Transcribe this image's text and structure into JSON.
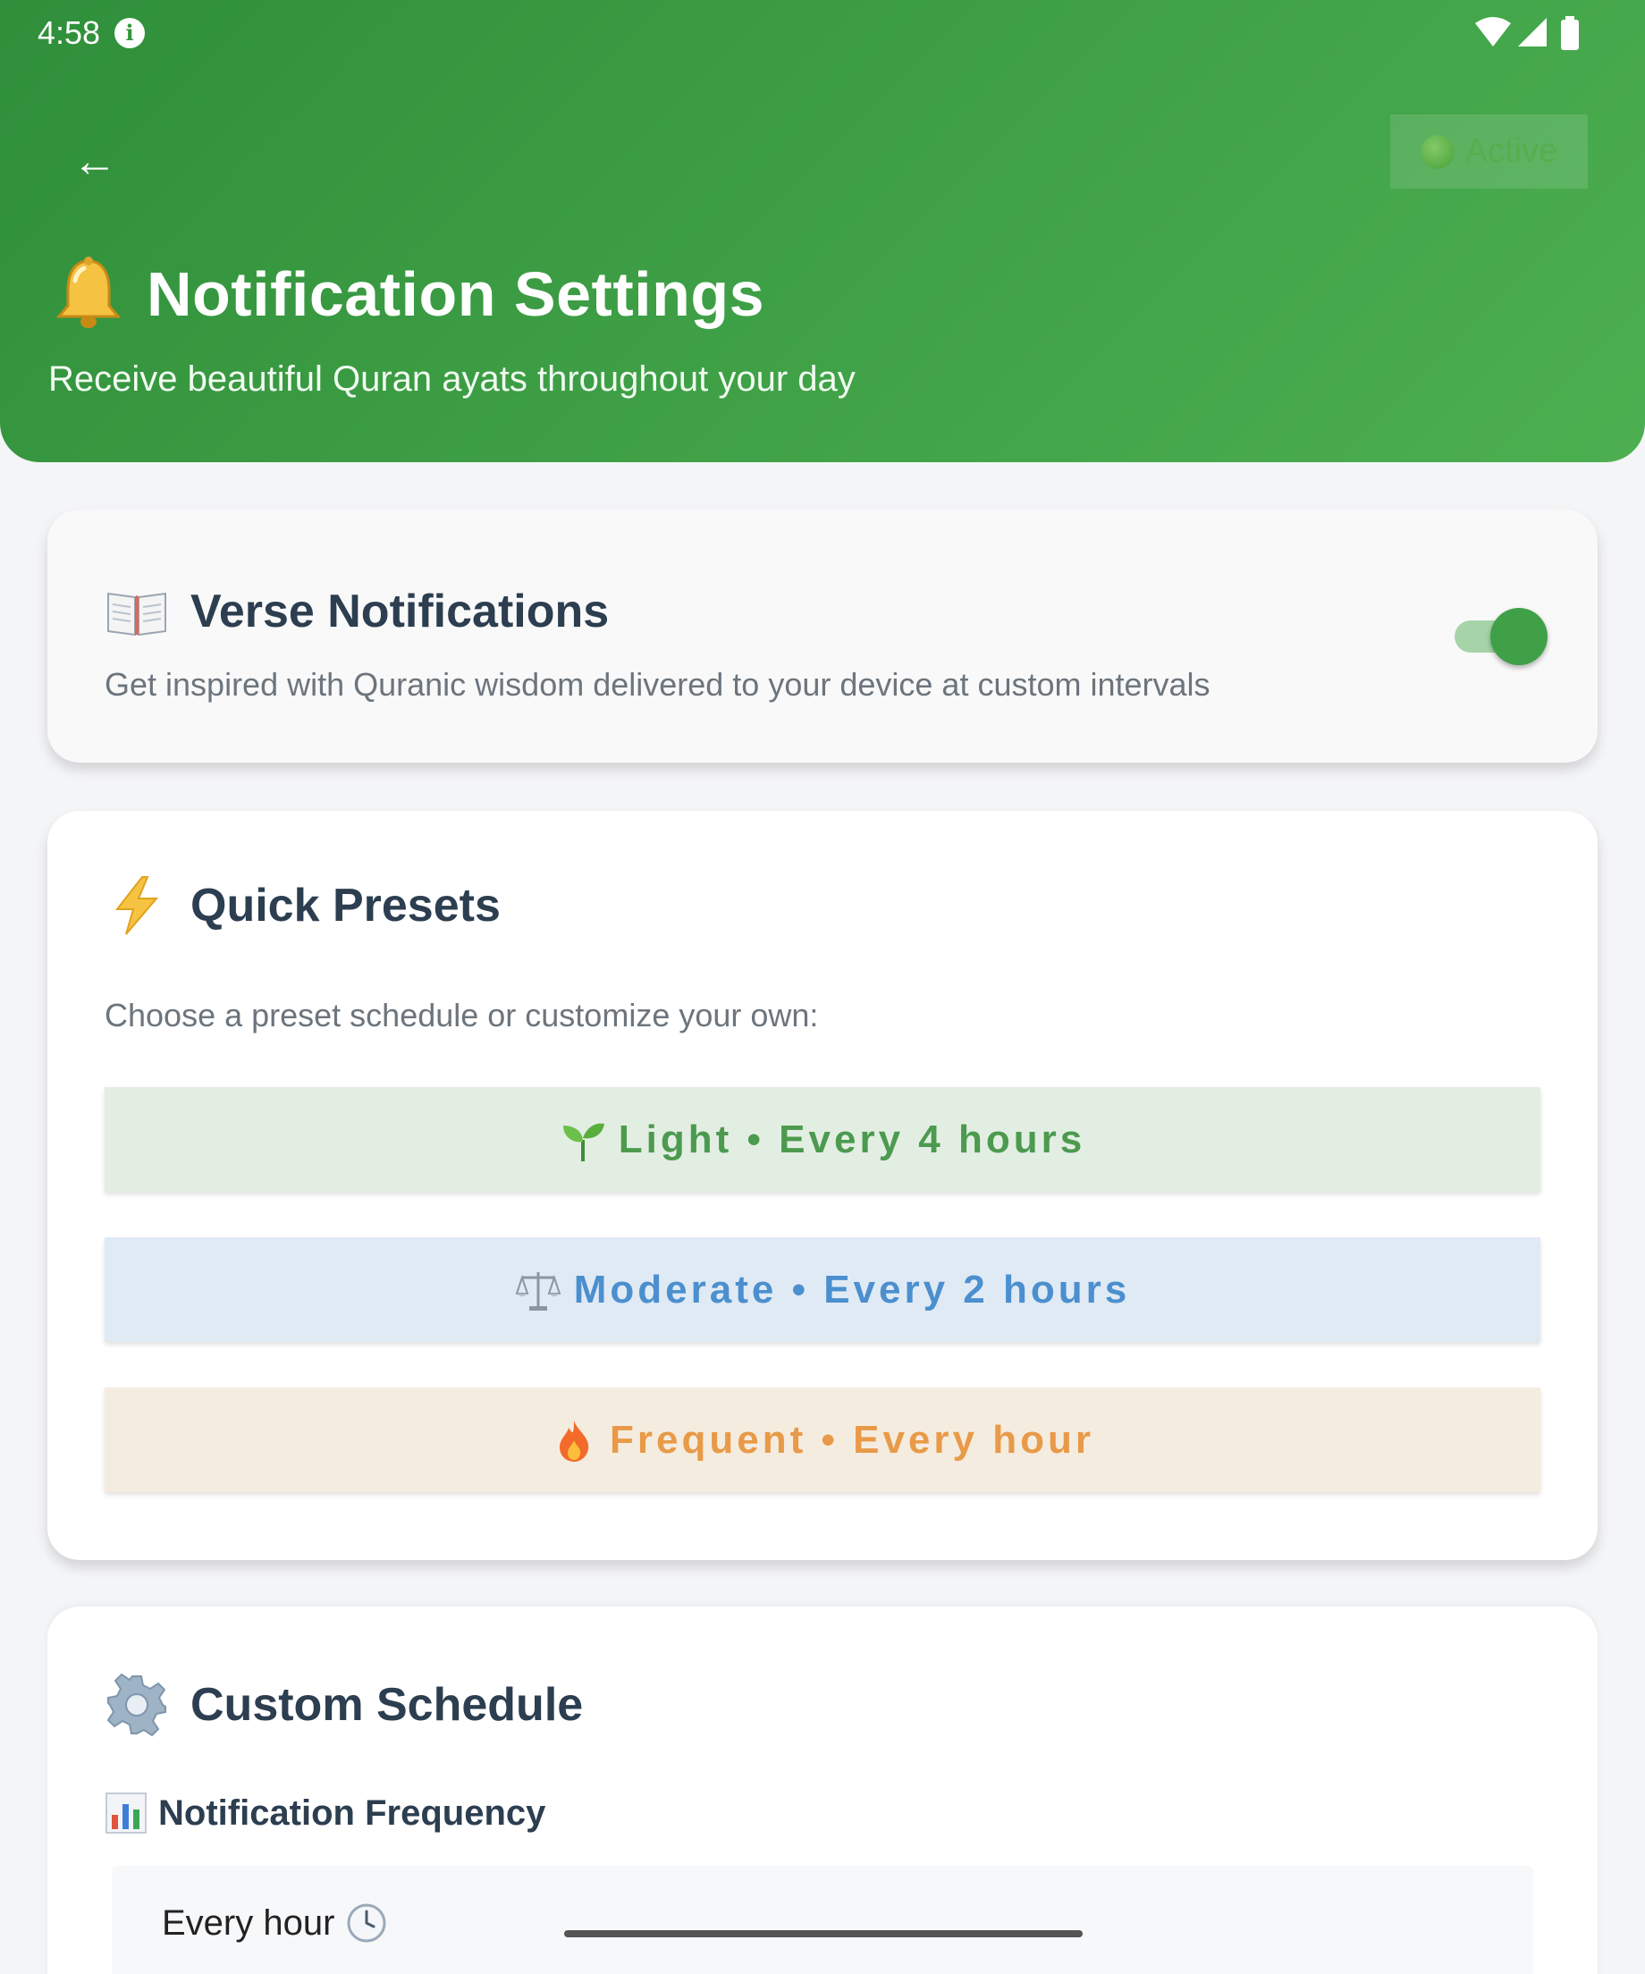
{
  "status_bar": {
    "time": "4:58"
  },
  "header": {
    "active_label": "Active",
    "title": "Notification Settings",
    "subtitle": "Receive beautiful Quran ayats throughout your day"
  },
  "verse_card": {
    "title": "Verse Notifications",
    "description": "Get inspired with Quranic wisdom delivered to your device at custom intervals",
    "toggle_on": true
  },
  "presets_card": {
    "title": "Quick Presets",
    "description": "Choose a preset schedule or customize your own:",
    "presets": [
      {
        "label": "Light • Every 4 hours",
        "icon": "seedling-icon"
      },
      {
        "label": "Moderate • Every 2 hours",
        "icon": "scales-icon"
      },
      {
        "label": "Frequent • Every hour",
        "icon": "fire-icon"
      }
    ]
  },
  "custom_card": {
    "title": "Custom Schedule",
    "frequency_label": "Notification Frequency",
    "frequency_value": "Every hour"
  },
  "colors": {
    "header_green": "#3d9e45",
    "light_bg": "#e3eee3",
    "moderate_bg": "#e0eaf4",
    "frequent_bg": "#f5ece0"
  }
}
